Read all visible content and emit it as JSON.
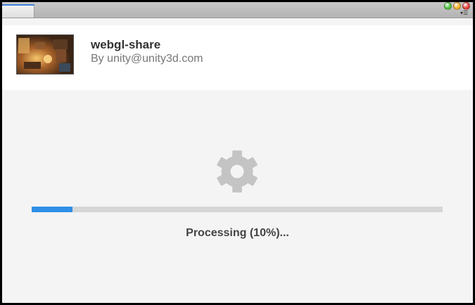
{
  "window": {
    "controls": [
      {
        "name": "minimize",
        "color": "#4fc43f"
      },
      {
        "name": "maximize",
        "color": "#f3b02b"
      },
      {
        "name": "close",
        "color": "#e5423a"
      }
    ],
    "menu_icon": "menu-dropdown-icon"
  },
  "app": {
    "title": "webgl-share",
    "author": "By unity@unity3d.com",
    "thumbnail_icon": "game-scene-thumbnail"
  },
  "processing": {
    "icon": "gear-icon",
    "progress_fraction": 0.1,
    "progress_color": "#2f8fe8",
    "track_color": "#d6d6d6",
    "status_text": "Processing (10%)..."
  }
}
